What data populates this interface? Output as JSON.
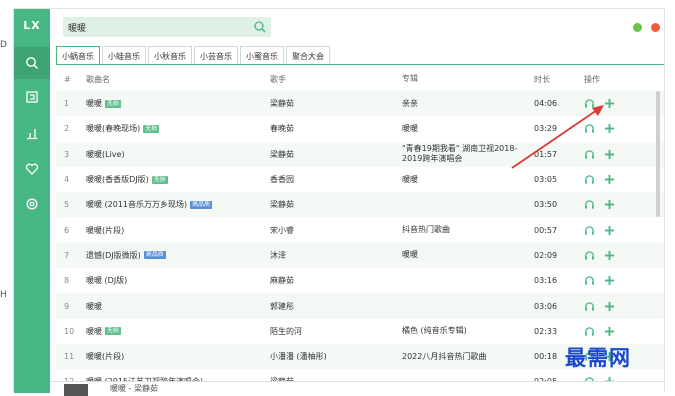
{
  "app": {
    "logo": "LX",
    "search": {
      "value": "暖暖"
    },
    "colors": {
      "accent": "#47b784",
      "dot_green": "#6cc24a",
      "dot_red": "#f05a3c"
    },
    "nav": [
      {
        "icon": "search-icon"
      },
      {
        "icon": "playlist-icon"
      },
      {
        "icon": "chart-icon"
      },
      {
        "icon": "heart-icon"
      },
      {
        "icon": "settings-icon"
      }
    ]
  },
  "tabs": [
    "小蜗音乐",
    "小蛙音乐",
    "小秋音乐",
    "小芸音乐",
    "小蜜音乐",
    "聚合大会"
  ],
  "table": {
    "headers": {
      "idx": "#",
      "name": "歌曲名",
      "singer": "歌手",
      "album": "专辑",
      "time": "时长",
      "ops": "操作"
    },
    "rows": [
      {
        "idx": "1",
        "name": "暖暖",
        "badge": "无损",
        "singer": "梁静茹",
        "album": "亲亲",
        "time": "04:06"
      },
      {
        "idx": "2",
        "name": "暖暖(春晚现场)",
        "badge": "无损",
        "singer": "春晚茹",
        "album": "暖暖",
        "time": "03:29"
      },
      {
        "idx": "3",
        "name": "暖暖(Live)",
        "badge": "",
        "singer": "梁静茹",
        "album": "\"青春19期我看\" 湖南卫视2018-2019跨年演唱会",
        "time": "01:57"
      },
      {
        "idx": "4",
        "name": "暖暖(香香版DJ版)",
        "badge": "无损",
        "singer": "香香园",
        "album": "暖暖",
        "time": "03:05"
      },
      {
        "idx": "5",
        "name": "暖暖 (2011音乐万万乡现场)",
        "badge": "高品质",
        "singer": "梁静茹",
        "album": "",
        "time": "03:50"
      },
      {
        "idx": "6",
        "name": "暖暖(片段)",
        "badge": "",
        "singer": "宋小睿",
        "album": "抖音热门歌曲",
        "time": "00:57"
      },
      {
        "idx": "7",
        "name": "遗憾(DJ版微版)",
        "badge": "高品质",
        "singer": "沐泽",
        "album": "暖暖",
        "time": "02:09"
      },
      {
        "idx": "8",
        "name": "暖暖 (DJ版)",
        "badge": "",
        "singer": "麻静茹",
        "album": "",
        "time": "03:16"
      },
      {
        "idx": "9",
        "name": "暖暖",
        "badge": "",
        "singer": "郭建彤",
        "album": "",
        "time": "03:06"
      },
      {
        "idx": "10",
        "name": "暖暖",
        "badge": "无损",
        "singer": "陌生的河",
        "album": "橘色 (纯音乐专辑)",
        "time": "02:33"
      },
      {
        "idx": "11",
        "name": "暖暖(片段)",
        "badge": "",
        "singer": "小潘潘 (潘柚彤)",
        "album": "2022八月抖音热门歌曲",
        "time": "00:18"
      },
      {
        "idx": "12",
        "name": "暖暖 (2015江苏卫视跨年演唱会)",
        "badge": "",
        "singer": "梁静茹",
        "album": "",
        "time": "02:05"
      }
    ]
  },
  "player": {
    "title": "暖暖 - 梁静茹"
  },
  "watermark": "最需网"
}
